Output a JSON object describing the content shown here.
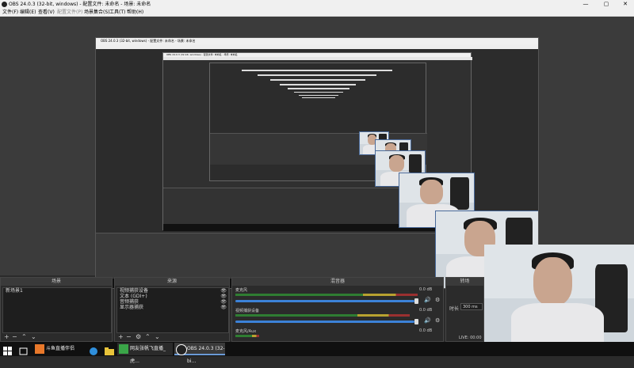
{
  "window": {
    "title": "OBS 24.0.3 (32-bit, windows) - 配置文件: 未命名 - 场景: 未命名",
    "controls": {
      "minimize": "—",
      "maximize": "▢",
      "close": "✕"
    }
  },
  "menu": [
    "文件(F)",
    "编辑(E)",
    "查看(V)",
    "配置文件(P)",
    "场景集合(S)",
    "工具(T)",
    "帮助(H)"
  ],
  "nested_titles": {
    "level1": "OBS 24.0.3 (32-bit, windows) - 配置文件: 未命名 - 场景: 未命名",
    "level2": "OBS 24.0.3 (32-bit, windows) - 配置文件: 未命名 - 场景: 未命名"
  },
  "docks": {
    "scenes": {
      "title": "场景",
      "items": [
        "新场景1"
      ]
    },
    "sources": {
      "title": "来源",
      "items": [
        "视频捕获设备",
        "文本 (GDI+)",
        "音频捕获",
        "显示器捕获"
      ]
    },
    "mixer": {
      "title": "混音器",
      "channels": [
        {
          "name": "麦克风",
          "db": "0.0 dB",
          "level": 0.85,
          "volume": 0.95
        },
        {
          "name": "视频捕获设备",
          "db": "0.0 dB",
          "level": 0.8,
          "volume": 0.95
        },
        {
          "name": "麦克风/Aux",
          "db": "0.0 dB",
          "level": 0.1,
          "volume": 0.95
        }
      ]
    },
    "transitions": {
      "title": "转场",
      "duration_label": "时长",
      "duration_value": "300 ms"
    }
  },
  "status": {
    "live": "LIVE: 00:00"
  },
  "taskbar": {
    "apps": [
      {
        "label": "斗鱼直播伴侣",
        "color": "#e8782a"
      },
      {
        "label": "网友张帆飞直播_虎…",
        "color": "#3aa548"
      },
      {
        "label": "OBS 24.0.3 (32-bi…",
        "color": "#ffffff"
      }
    ]
  },
  "colors": {
    "accent": "#3c82d8",
    "meter_green": "#2f7d32",
    "meter_yellow": "#b8a230",
    "meter_red": "#9a3030"
  }
}
